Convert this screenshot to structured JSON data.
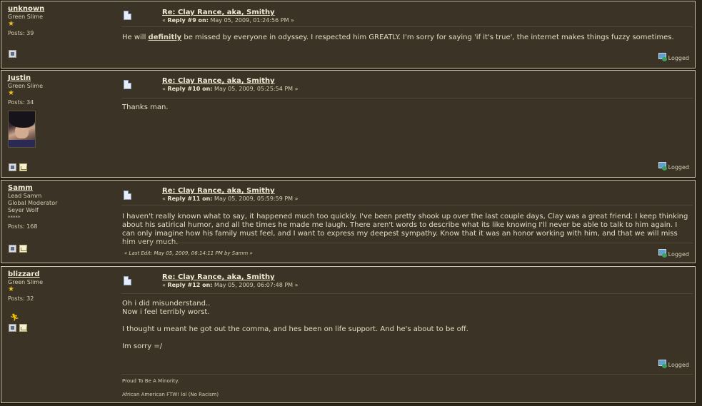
{
  "posts": [
    {
      "name": "unknown",
      "group": "Green Slime",
      "stars": "★",
      "posts_count": "Posts: 39",
      "subject": "Re: Clay Rance, aka, Smithy",
      "reply_prefix": "« ",
      "reply_label": "Reply #9 on:",
      "reply_date": " May 05, 2009, 01:24:56 PM »",
      "body_before": "He will ",
      "body_emph": "definitly",
      "body_after": " be missed by everyone in odyssey. I respected him GREATLY. I'm sorry for saying 'if it's true', the internet makes things fuzzy sometimes.",
      "logged": "Logged"
    },
    {
      "name": "Justin",
      "group": "Green Slime",
      "stars": "★",
      "posts_count": "Posts: 34",
      "subject": "Re: Clay Rance, aka, Smithy",
      "reply_prefix": "« ",
      "reply_label": "Reply #10 on:",
      "reply_date": " May 05, 2009, 05:25:54 PM »",
      "body": "Thanks man.",
      "logged": "Logged"
    },
    {
      "name": "Samm",
      "title1": "Lead Samm",
      "title2": "Global Moderator",
      "title3": "Seyer Wolf",
      "stars": "*****",
      "posts_count": "Posts: 168",
      "subject": "Re: Clay Rance, aka, Smithy",
      "reply_prefix": "« ",
      "reply_label": "Reply #11 on:",
      "reply_date": " May 05, 2009, 05:59:59 PM »",
      "body": "I haven't really known what to say, it happened much too quickly.  I've been pretty shook up over the last couple days, Clay was a great friend; I keep thinking about his satirical humor, and all the times he made me laugh.  There aren't words to describe what its like knowing I'll never be able to talk to him again. I can only imagine how his family must feel, and I want to express my deepest sympathy.  Know that it was an honor working with him, and that we will miss him very much.",
      "last_edit": "« Last Edit: May 05, 2009, 06:14:11 PM by Samm »",
      "logged": "Logged"
    },
    {
      "name": "blizzard",
      "group": "Green Slime",
      "stars": "★",
      "posts_count": "Posts: 32",
      "subject": "Re: Clay Rance, aka, Smithy",
      "reply_prefix": "« ",
      "reply_label": "Reply #12 on:",
      "reply_date": " May 05, 2009, 06:07:48 PM »",
      "body_line1": "Oh i did misunderstand..",
      "body_line2": "Now i feel terribly worst.",
      "body_line3": "I thought u meant he got out the comma, and hes been on life support. And he's about to be off.",
      "body_line4": "Im sorry =/",
      "logged": "Logged",
      "sig_line1": "Proud To Be A Minority.",
      "sig_line2": "African American FTW! lol (No Racism)"
    }
  ],
  "icons": {
    "profile": "profile-icon",
    "mail": "email-icon",
    "doc": "post-icon",
    "logged": "logged-icon",
    "online": "online-status-icon"
  },
  "colors": {
    "background": "#2a2419",
    "post_bg": "#3a3326",
    "border": "#cfc6ad",
    "text": "#e6dcc4",
    "star": "#f0c020"
  }
}
